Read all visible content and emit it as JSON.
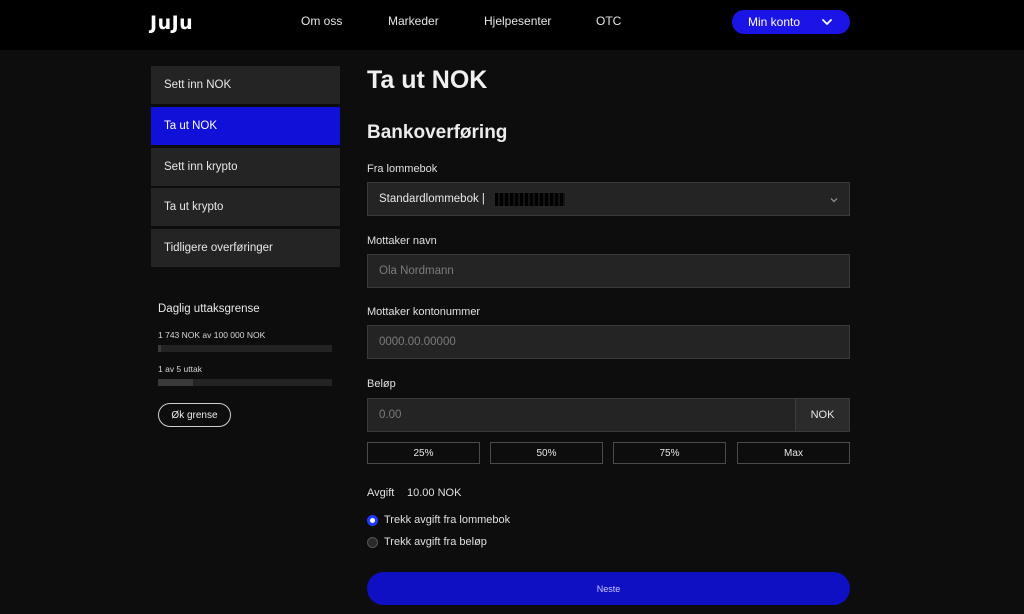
{
  "brand": {
    "logo": "JuJu"
  },
  "nav": {
    "items": [
      "Om oss",
      "Markeder",
      "Hjelpesenter",
      "OTC"
    ],
    "account_label": "Min konto"
  },
  "sidebar": {
    "items": [
      {
        "label": "Sett inn NOK",
        "active": false
      },
      {
        "label": "Ta ut NOK",
        "active": true
      },
      {
        "label": "Sett inn krypto",
        "active": false
      },
      {
        "label": "Ta ut krypto",
        "active": false
      },
      {
        "label": "Tidligere overføringer",
        "active": false
      }
    ],
    "limit": {
      "title": "Daglig uttaksgrense",
      "amount_text": "1 743 NOK av 100 000 NOK",
      "amount_fraction": 0.017,
      "count_text": "1 av 5 uttak",
      "count_fraction": 0.2,
      "raise_label": "Øk grense"
    }
  },
  "main": {
    "title": "Ta ut NOK",
    "section_title": "Bankoverføring",
    "from_wallet": {
      "label": "Fra lommebok",
      "value": "Standardlommebok  |"
    },
    "recipient_name": {
      "label": "Mottaker navn",
      "placeholder": "Ola Nordmann"
    },
    "recipient_account": {
      "label": "Mottaker kontonummer",
      "placeholder": "0000.00.00000"
    },
    "amount": {
      "label": "Beløp",
      "placeholder": "0.00",
      "unit": "NOK"
    },
    "percent_buttons": [
      "25%",
      "50%",
      "75%",
      "Max"
    ],
    "fee": {
      "label": "Avgift",
      "value": "10.00 NOK"
    },
    "fee_options": [
      {
        "label": "Trekk avgift fra lommebok",
        "selected": true
      },
      {
        "label": "Trekk avgift fra beløp",
        "selected": false
      }
    ],
    "submit_label": "Neste"
  },
  "colors": {
    "accent": "#1010d8",
    "background": "#0d0d0d",
    "panel": "#242424"
  }
}
